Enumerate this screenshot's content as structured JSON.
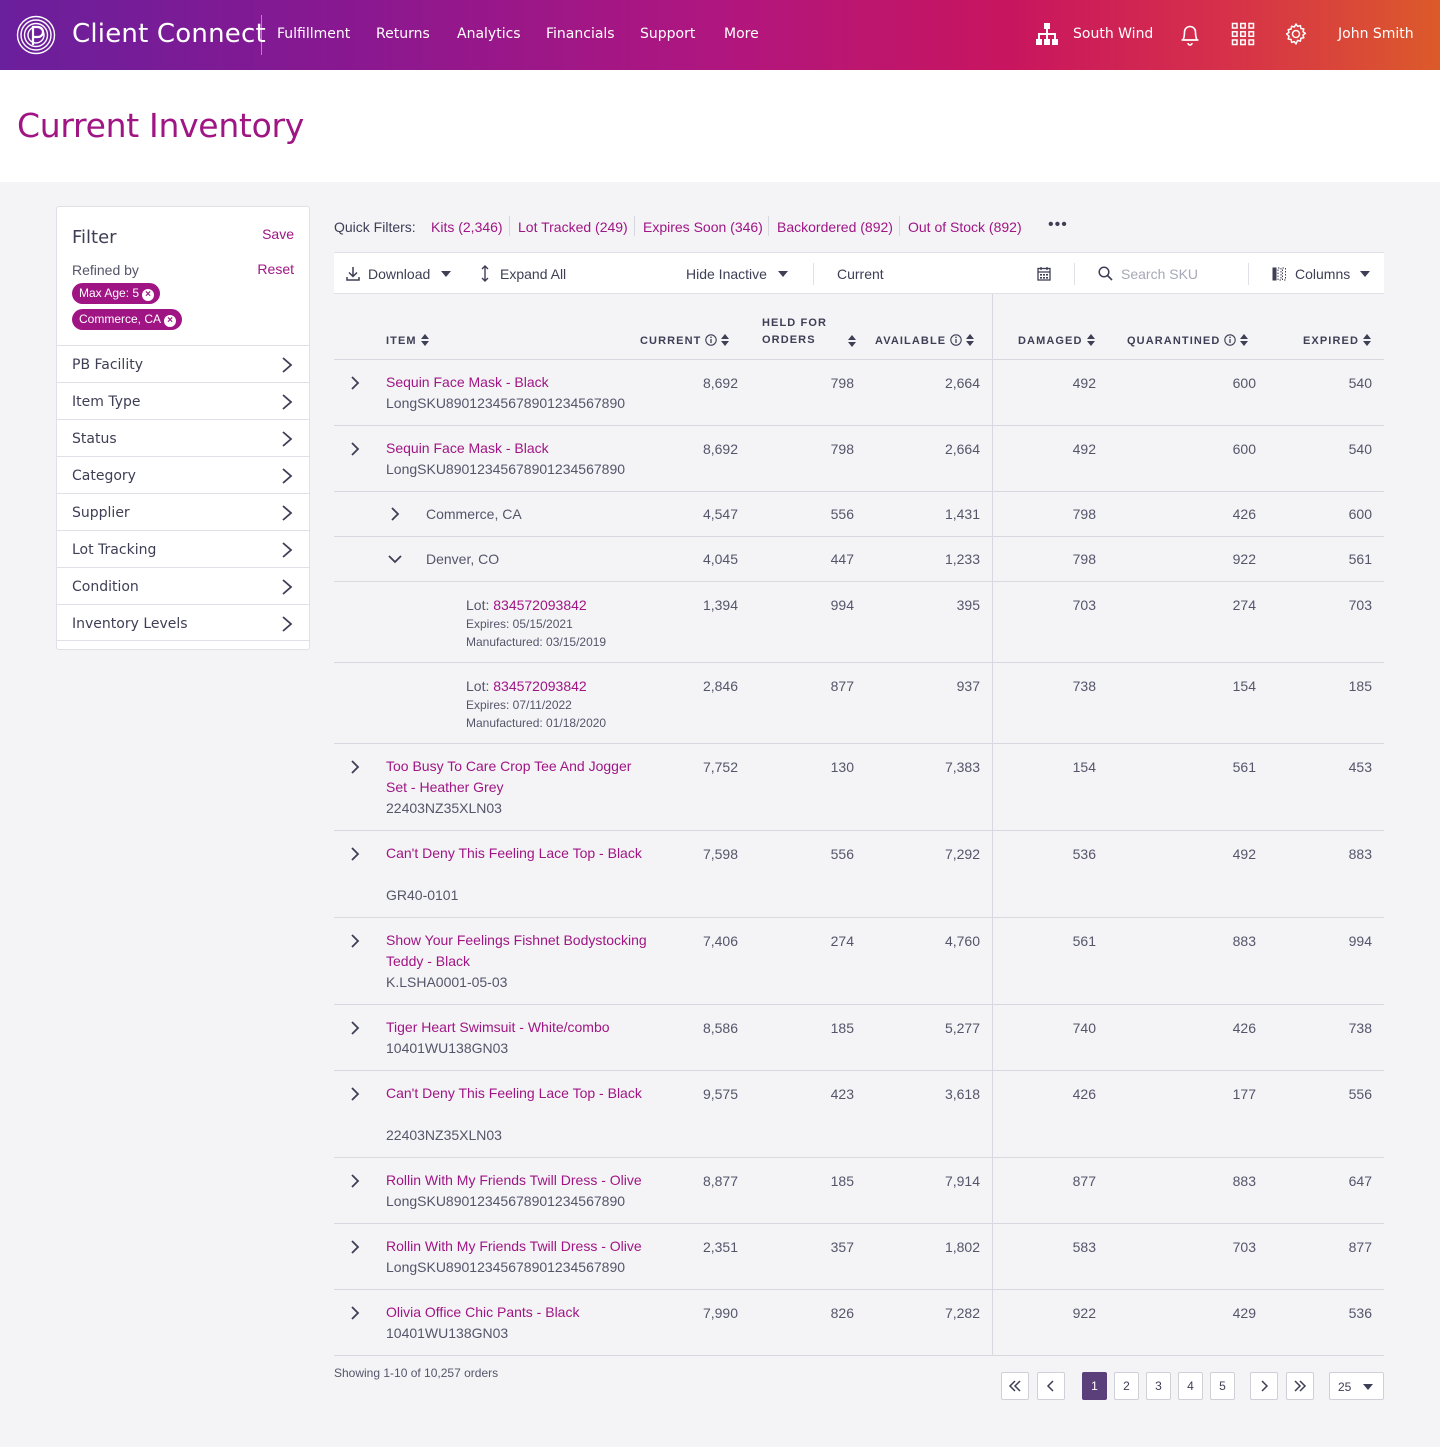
{
  "header": {
    "brand": "Client Connect",
    "nav": [
      "Fulfillment",
      "Returns",
      "Analytics",
      "Financials",
      "Support",
      "More"
    ],
    "org": "South Wind",
    "user": "John Smith"
  },
  "page": {
    "title": "Current Inventory"
  },
  "filter": {
    "title": "Filter",
    "save": "Save",
    "refined_by": "Refined by",
    "reset": "Reset",
    "chips": [
      "Max Age: 5",
      "Commerce, CA"
    ],
    "facets": [
      "PB Facility",
      "Item Type",
      "Status",
      "Category",
      "Supplier",
      "Lot Tracking",
      "Condition",
      "Inventory Levels"
    ]
  },
  "quick_filters": {
    "label": "Quick Filters:",
    "items": [
      "Kits (2,346)",
      "Lot Tracked (249)",
      "Expires Soon (346)",
      "Backordered (892)",
      "Out of Stock (892)"
    ],
    "more": "•••"
  },
  "toolbar": {
    "download": "Download",
    "expand_all": "Expand All",
    "hide_inactive": "Hide Inactive",
    "date_value": "Current",
    "search_placeholder": "Search SKU",
    "columns": "Columns"
  },
  "table": {
    "columns": {
      "item": "ITEM",
      "current": "CURRENT",
      "held_1": "HELD FOR",
      "held_2": "ORDERS",
      "available": "AVAILABLE",
      "damaged": "DAMAGED",
      "quarantined": "QUARANTINED",
      "expired": "EXPIRED"
    },
    "rows": [
      {
        "name": "Sequin Face Mask - Black",
        "sku": "LongSKU89012345678901234567890",
        "current": "8,692",
        "held": "798",
        "available": "2,664",
        "damaged": "492",
        "quarantined": "600",
        "expired": "540"
      },
      {
        "name": "Sequin Face Mask - Black",
        "sku": "LongSKU89012345678901234567890",
        "current": "8,692",
        "held": "798",
        "available": "2,664",
        "damaged": "492",
        "quarantined": "600",
        "expired": "540"
      },
      {
        "location": "Commerce, CA",
        "current": "4,547",
        "held": "556",
        "available": "1,431",
        "damaged": "798",
        "quarantined": "426",
        "expired": "600"
      },
      {
        "location": "Denver, CO",
        "current": "4,045",
        "held": "447",
        "available": "1,233",
        "damaged": "798",
        "quarantined": "922",
        "expired": "561"
      },
      {
        "lot_label": "Lot:",
        "lot": "834572093842",
        "expires": "Expires: 05/15/2021",
        "manufactured": "Manufactured: 03/15/2019",
        "current": "1,394",
        "held": "994",
        "available": "395",
        "damaged": "703",
        "quarantined": "274",
        "expired": "703"
      },
      {
        "lot_label": "Lot:",
        "lot": "834572093842",
        "expires": "Expires: 07/11/2022",
        "manufactured": "Manufactured: 01/18/2020",
        "current": "2,846",
        "held": "877",
        "available": "937",
        "damaged": "738",
        "quarantined": "154",
        "expired": "185"
      },
      {
        "name": "Too Busy To Care Crop Tee And Jogger Set - Heather Grey",
        "sku": "22403NZ35XLN03",
        "current": "7,752",
        "held": "130",
        "available": "7,383",
        "damaged": "154",
        "quarantined": "561",
        "expired": "453"
      },
      {
        "name": "Can't Deny This Feeling Lace Top - Black",
        "sku": "GR40-0101",
        "current": "7,598",
        "held": "556",
        "available": "7,292",
        "damaged": "536",
        "quarantined": "492",
        "expired": "883"
      },
      {
        "name": "Show Your Feelings Fishnet Bodystocking Teddy - Black",
        "sku": "K.LSHA0001-05-03",
        "current": "7,406",
        "held": "274",
        "available": "4,760",
        "damaged": "561",
        "quarantined": "883",
        "expired": "994"
      },
      {
        "name": "Tiger Heart Swimsuit - White/combo",
        "sku": "10401WU138GN03",
        "current": "8,586",
        "held": "185",
        "available": "5,277",
        "damaged": "740",
        "quarantined": "426",
        "expired": "738"
      },
      {
        "name": "Can't Deny This Feeling Lace Top - Black",
        "sku": "22403NZ35XLN03",
        "current": "9,575",
        "held": "423",
        "available": "3,618",
        "damaged": "426",
        "quarantined": "177",
        "expired": "556"
      },
      {
        "name": "Rollin With My Friends Twill Dress - Olive",
        "sku": "LongSKU89012345678901234567890",
        "current": "8,877",
        "held": "185",
        "available": "7,914",
        "damaged": "877",
        "quarantined": "883",
        "expired": "647"
      },
      {
        "name": "Rollin With My Friends Twill Dress - Olive",
        "sku": "LongSKU89012345678901234567890",
        "current": "2,351",
        "held": "357",
        "available": "1,802",
        "damaged": "583",
        "quarantined": "703",
        "expired": "877"
      },
      {
        "name": "Olivia Office Chic Pants - Black",
        "sku": "10401WU138GN03",
        "current": "7,990",
        "held": "826",
        "available": "7,282",
        "damaged": "922",
        "quarantined": "429",
        "expired": "536"
      }
    ]
  },
  "footer": {
    "showing": "Showing 1-10 of 10,257 orders",
    "pages": [
      "1",
      "2",
      "3",
      "4",
      "5"
    ],
    "active_page": "1",
    "page_size": "25"
  },
  "colors": {
    "accent": "#a01584",
    "active_page": "#5b3f7a"
  }
}
